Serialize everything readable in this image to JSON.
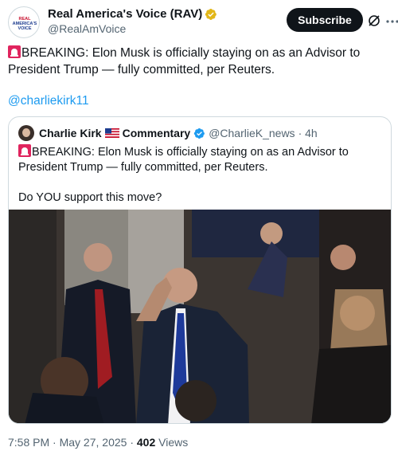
{
  "author": {
    "display_name": "Real America's Voice (RAV)",
    "handle": "@RealAmVoice",
    "avatar_text_line1": "REAL",
    "avatar_text_line2": "AMERICA'S",
    "avatar_text_line3": "VOICE"
  },
  "actions": {
    "subscribe_label": "Subscribe",
    "grok_icon": "grok-icon",
    "more_icon": "more-icon"
  },
  "tweet": {
    "text": "BREAKING: Elon Musk is officially staying on as an Advisor to President Trump — fully committed, per Reuters.",
    "mention": "@charliekirk11"
  },
  "quote": {
    "author_name": "Charlie Kirk",
    "author_label": "Commentary",
    "handle": "@CharlieK_news",
    "time": "· 4h",
    "text": "BREAKING: Elon Musk is officially staying on as an Advisor to President Trump — fully committed, per Reuters.",
    "question": "Do YOU support this move?"
  },
  "meta": {
    "time": "7:58 PM",
    "sep1": "·",
    "date": "May 27, 2025",
    "sep2": "·",
    "views_count": "402",
    "views_label": "Views"
  },
  "colors": {
    "link": "#1d9bf0",
    "muted": "#536471",
    "badge_blue": "#1d9bf0",
    "badge_gold": "#e2b719"
  }
}
